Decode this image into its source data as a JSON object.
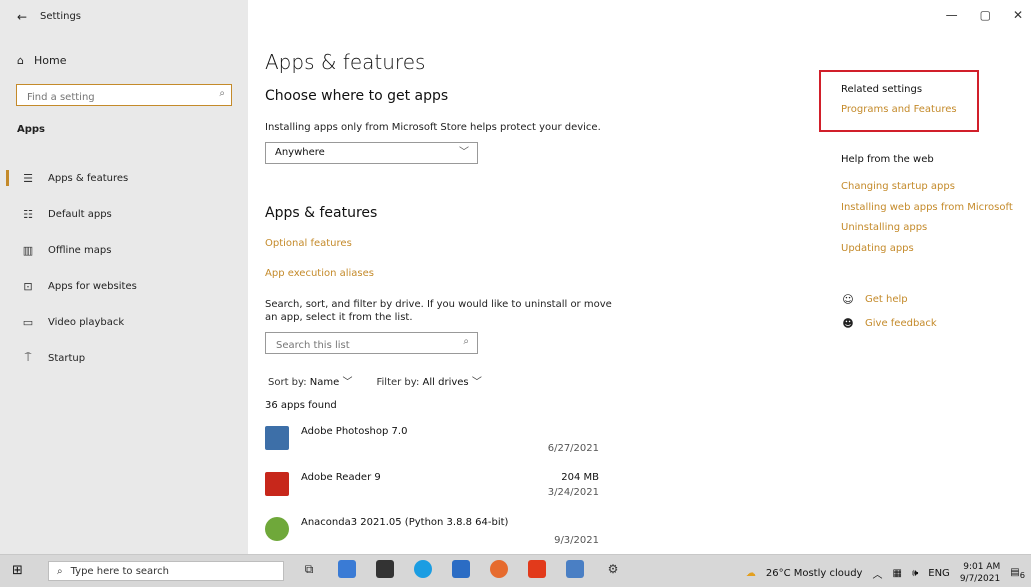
{
  "window": {
    "title": "Settings",
    "back_icon": "←",
    "controls": [
      "—",
      "▢",
      "✕"
    ]
  },
  "sidebar": {
    "home_label": "Home",
    "search_placeholder": "Find a setting",
    "section_label": "Apps",
    "items": [
      {
        "label": "Apps & features",
        "icon": "apps-features-icon",
        "active": true
      },
      {
        "label": "Default apps",
        "icon": "default-apps-icon",
        "active": false
      },
      {
        "label": "Offline maps",
        "icon": "offline-maps-icon",
        "active": false
      },
      {
        "label": "Apps for websites",
        "icon": "apps-for-websites-icon",
        "active": false
      },
      {
        "label": "Video playback",
        "icon": "video-playback-icon",
        "active": false
      },
      {
        "label": "Startup",
        "icon": "startup-icon",
        "active": false
      }
    ]
  },
  "main": {
    "title": "Apps & features",
    "choose_heading": "Choose where to get apps",
    "choose_desc": "Installing apps only from Microsoft Store helps protect your device.",
    "source_selected": "Anywhere",
    "apps_heading": "Apps & features",
    "optional_features": "Optional features",
    "app_execution_aliases": "App execution aliases",
    "search_desc": "Search, sort, and filter by drive. If you would like to uninstall or move an app, select it from the list.",
    "search_placeholder": "Search this list",
    "sort_label": "Sort by:",
    "sort_value": "Name",
    "filter_label": "Filter by:",
    "filter_value": "All drives",
    "apps_found": "36 apps found",
    "apps": [
      {
        "name": "Adobe Photoshop 7.0",
        "size": "",
        "date": "6/27/2021"
      },
      {
        "name": "Adobe Reader 9",
        "size": "204 MB",
        "date": "3/24/2021"
      },
      {
        "name": "Anaconda3 2021.05 (Python 3.8.8 64-bit)",
        "size": "",
        "date": "9/3/2021"
      }
    ]
  },
  "right_panel": {
    "related_title": "Related settings",
    "related_link": "Programs and Features",
    "help_title": "Help from the web",
    "help_links": [
      "Changing startup apps",
      "Installing web apps from Microsoft",
      "Uninstalling apps",
      "Updating apps"
    ],
    "get_help": "Get help",
    "give_feedback": "Give feedback"
  },
  "taskbar": {
    "search_placeholder": "Type here to search",
    "weather": "26°C  Mostly cloudy",
    "language": "ENG",
    "time": "9:01 AM",
    "date": "9/7/2021",
    "notification_count": "6"
  },
  "colors": {
    "accent": "#c48a2a",
    "highlight_box": "#d11f2a",
    "sidebar_bg": "#e9e9e9"
  }
}
